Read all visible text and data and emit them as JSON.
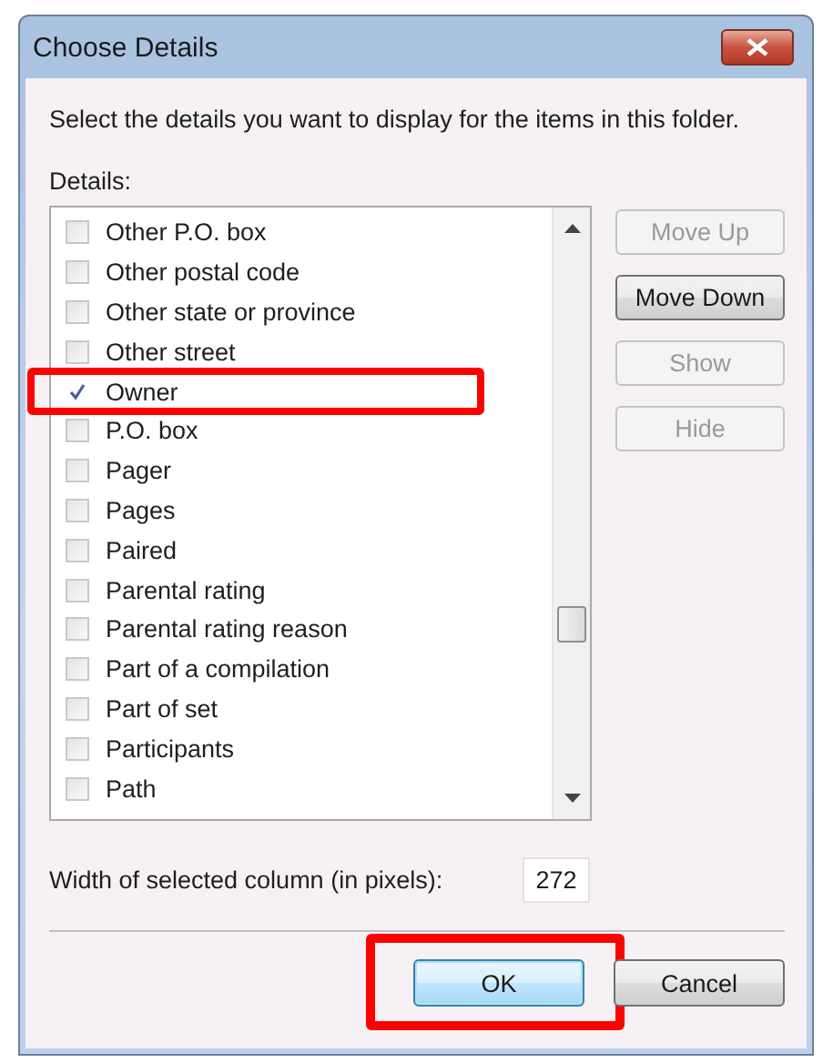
{
  "window": {
    "title": "Choose Details"
  },
  "instructions": "Select the details you want to display for the items in this folder.",
  "details_label": "Details:",
  "items": [
    {
      "label": "Other P.O. box",
      "checked": false,
      "highlighted": false
    },
    {
      "label": "Other postal code",
      "checked": false,
      "highlighted": false
    },
    {
      "label": "Other state or province",
      "checked": false,
      "highlighted": false
    },
    {
      "label": "Other street",
      "checked": false,
      "highlighted": false
    },
    {
      "label": "Owner",
      "checked": true,
      "highlighted": true
    },
    {
      "label": "P.O. box",
      "checked": false,
      "highlighted": false
    },
    {
      "label": "Pager",
      "checked": false,
      "highlighted": false
    },
    {
      "label": "Pages",
      "checked": false,
      "highlighted": false
    },
    {
      "label": "Paired",
      "checked": false,
      "highlighted": false
    },
    {
      "label": "Parental rating",
      "checked": false,
      "highlighted": false
    },
    {
      "label": "Parental rating reason",
      "checked": false,
      "highlighted": false
    },
    {
      "label": "Part of a compilation",
      "checked": false,
      "highlighted": false
    },
    {
      "label": "Part of set",
      "checked": false,
      "highlighted": false
    },
    {
      "label": "Participants",
      "checked": false,
      "highlighted": false
    },
    {
      "label": "Path",
      "checked": false,
      "highlighted": false
    }
  ],
  "side_buttons": [
    {
      "label": "Move Up",
      "disabled": true
    },
    {
      "label": "Move Down",
      "disabled": false
    },
    {
      "label": "Show",
      "disabled": true
    },
    {
      "label": "Hide",
      "disabled": true
    }
  ],
  "width_field": {
    "label": "Width of selected column (in pixels):",
    "value": "272"
  },
  "dialog_buttons": [
    {
      "label": "OK",
      "default": true,
      "highlighted": true
    },
    {
      "label": "Cancel",
      "default": false,
      "highlighted": false
    }
  ]
}
